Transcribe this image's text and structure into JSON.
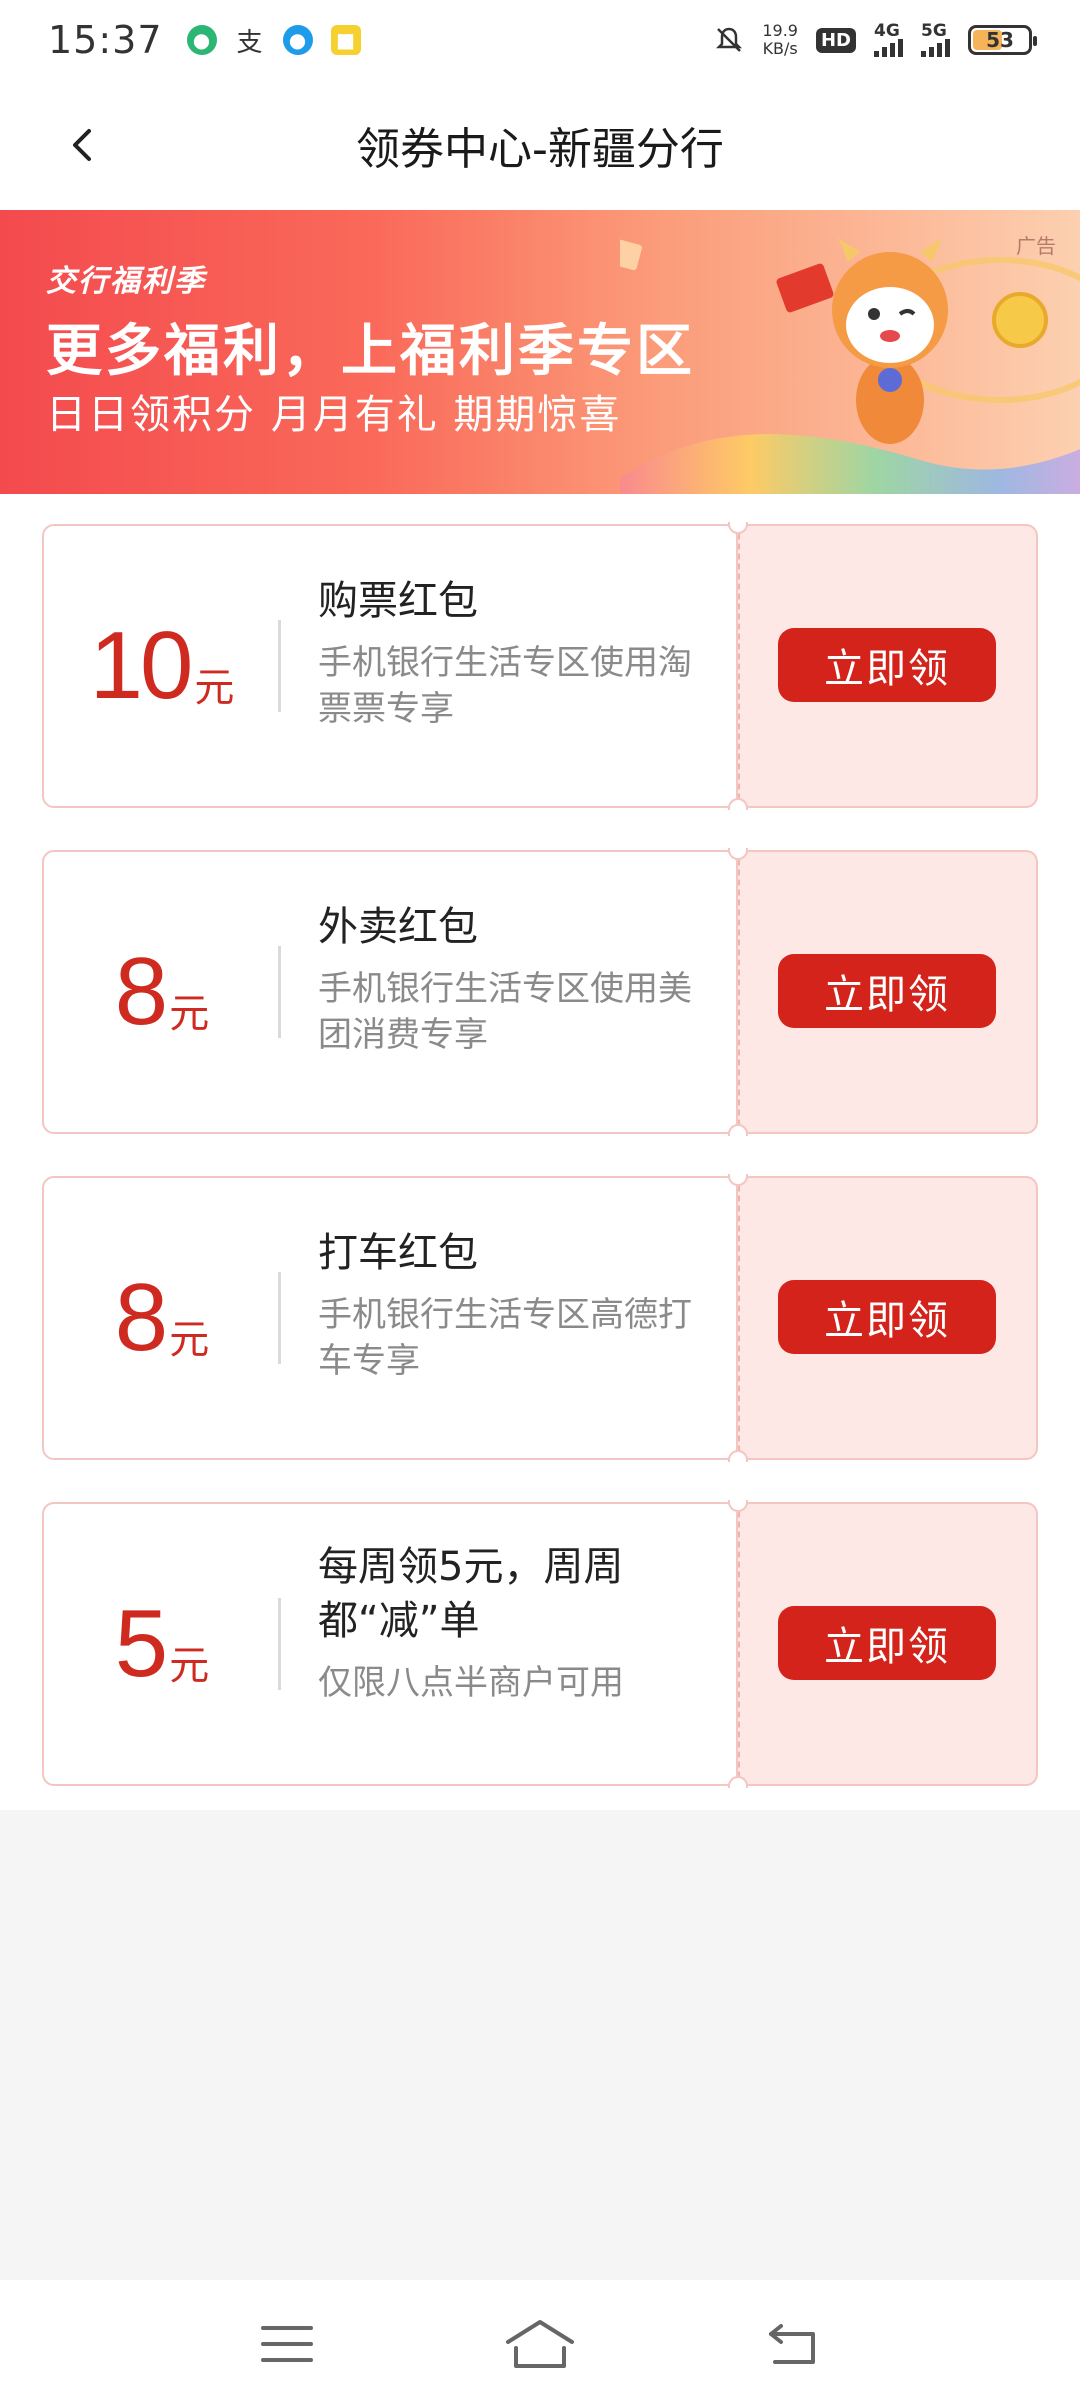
{
  "status_bar": {
    "time": "15:37",
    "net_speed_value": "19.9",
    "net_speed_unit": "KB/s",
    "hd": "HD",
    "sim1_net": "4G",
    "sim2_net": "5G",
    "battery": "53",
    "battery_level": 0.53
  },
  "header": {
    "title": "领券中心-新疆分行"
  },
  "banner": {
    "brand": "交行福利季",
    "title": "更多福利，上福利季专区",
    "subtitle": "日日领积分 月月有礼 期期惊喜",
    "ad_label": "广告"
  },
  "coupons": [
    {
      "amount": "10",
      "unit": "元",
      "title": "购票红包",
      "desc": "手机银行生活专区使用淘票票专享",
      "button": "立即领"
    },
    {
      "amount": "8",
      "unit": "元",
      "title": "外卖红包",
      "desc": "手机银行生活专区使用美团消费专享",
      "button": "立即领"
    },
    {
      "amount": "8",
      "unit": "元",
      "title": "打车红包",
      "desc": "手机银行生活专区高德打车专享",
      "button": "立即领"
    },
    {
      "amount": "5",
      "unit": "元",
      "title": "每周领5元，周周都“减”单",
      "desc": "仅限八点半商户可用",
      "button": "立即领"
    }
  ],
  "colors": {
    "accent": "#d3231a",
    "amount": "#cf2a1f",
    "coupon_right_bg": "#fde8e6",
    "coupon_border": "#f3c6c2"
  },
  "icons": {
    "back": "back-arrow-icon",
    "menu": "menu-icon",
    "home": "home-icon",
    "return": "return-icon"
  }
}
